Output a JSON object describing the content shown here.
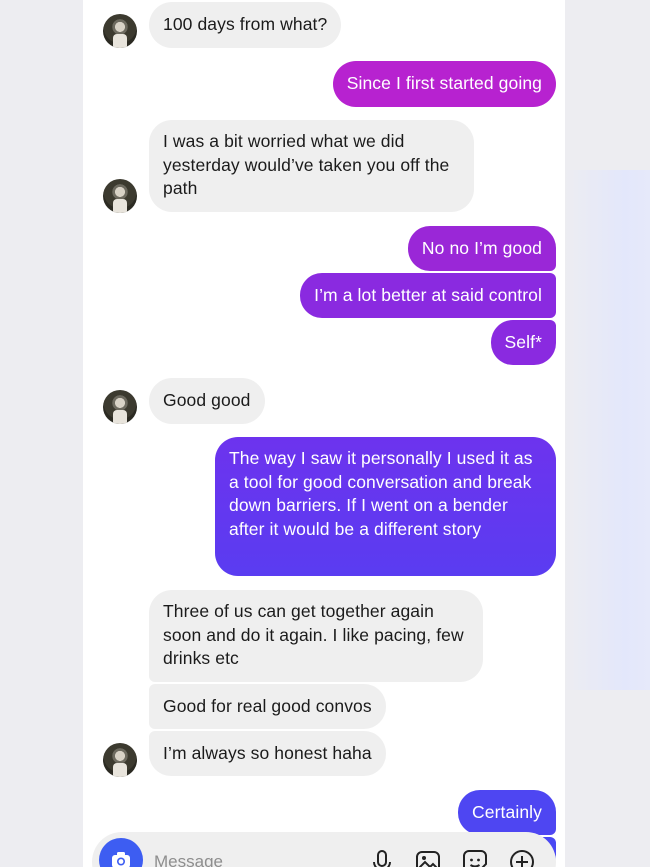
{
  "conversation": {
    "messages": [
      {
        "text": "100 days from what?"
      },
      {
        "text": "Since I first started going"
      },
      {
        "text": "I was a bit worried what we did yesterday would’ve taken you off the path"
      },
      {
        "text": "No no I’m good"
      },
      {
        "text": "I’m a lot better at said control"
      },
      {
        "text": "Self*"
      },
      {
        "text": "Good good"
      },
      {
        "text": "The way I saw it personally I used it as a tool for good conversation and break down barriers. If I went on a bender after it would be a different story"
      },
      {
        "text": "Three of us can get together again soon and do it again. I like pacing, few drinks etc"
      },
      {
        "text": "Good for real good convos"
      },
      {
        "text": "I’m always so honest haha"
      },
      {
        "text": "Certainly"
      }
    ]
  },
  "composer": {
    "placeholder": "Message",
    "icons": [
      "camera-icon",
      "microphone-icon",
      "gallery-icon",
      "sticker-icon",
      "plus-icon"
    ]
  },
  "colors": {
    "incoming_bubble": "#efefef",
    "outgoing_magenta": "#b722d0",
    "outgoing_purple": "#8a2ae0",
    "outgoing_indigo": "#6b35ef",
    "outgoing_blue": "#4e46f2",
    "camera_button": "#3d5df2"
  }
}
